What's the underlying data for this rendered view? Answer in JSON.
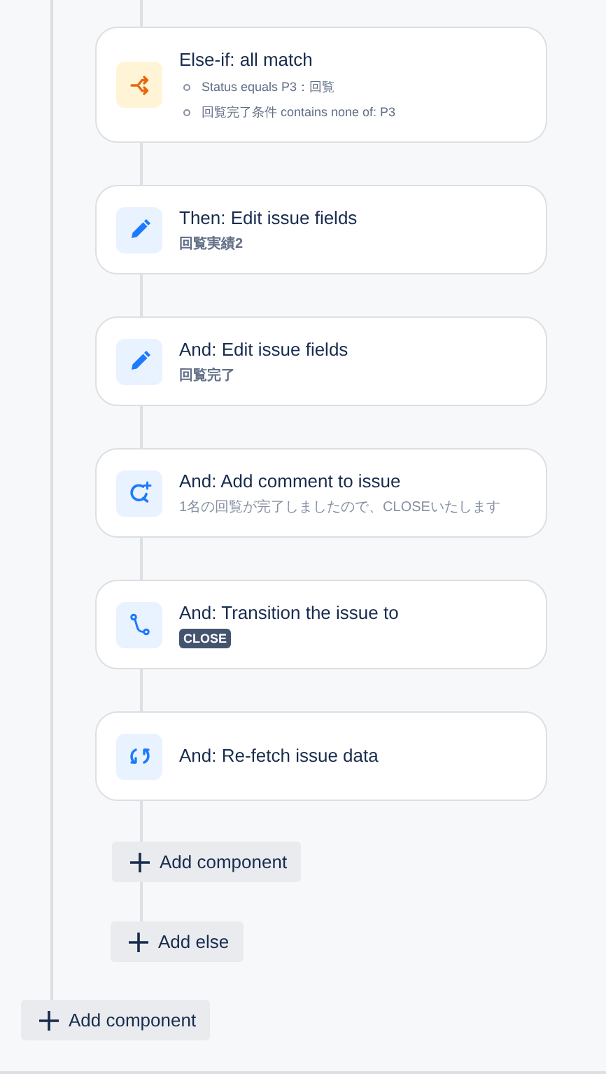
{
  "steps": [
    {
      "kind": "condition",
      "title": "Else-if: all match",
      "conditions": [
        "Status equals P3：回覧",
        "回覧完了条件 contains none of: P3"
      ]
    },
    {
      "kind": "fields",
      "title": "Then: Edit issue fields",
      "detail": "回覧実績2"
    },
    {
      "kind": "fields",
      "title": "And: Edit issue fields",
      "detail": "回覧完了"
    },
    {
      "kind": "comment",
      "title": "And: Add comment to issue",
      "detail": "1名の回覧が完了しましたので、CLOSEいたします"
    },
    {
      "kind": "status",
      "title": "And: Transition the issue to",
      "detail": "CLOSE"
    },
    {
      "kind": "plain",
      "title": "And: Re-fetch issue data"
    }
  ],
  "inner_add_button": "Add component",
  "add_else_button": "Add else",
  "outer_add_button": "Add component"
}
